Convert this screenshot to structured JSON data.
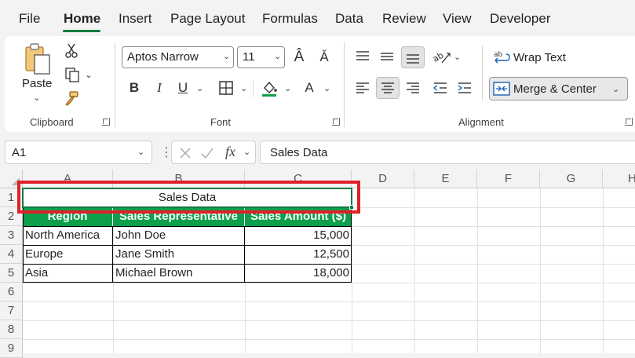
{
  "menu": {
    "tabs": [
      {
        "label": "File"
      },
      {
        "label": "Home"
      },
      {
        "label": "Insert"
      },
      {
        "label": "Page Layout"
      },
      {
        "label": "Formulas"
      },
      {
        "label": "Data"
      },
      {
        "label": "Review"
      },
      {
        "label": "View"
      },
      {
        "label": "Developer"
      }
    ],
    "active": "Home"
  },
  "ribbon": {
    "clipboard": {
      "label": "Clipboard",
      "paste_label": "Paste"
    },
    "font": {
      "label": "Font",
      "font_name": "Aptos Narrow",
      "font_size": "11",
      "bold": "B",
      "italic": "I",
      "underline": "U",
      "font_color_glyph": "A"
    },
    "alignment": {
      "label": "Alignment",
      "wrap_text": "Wrap Text",
      "merge_center": "Merge & Center"
    }
  },
  "formula_bar": {
    "name_box": "A1",
    "fx": "fx",
    "content": "Sales Data"
  },
  "grid": {
    "columns": [
      "A",
      "B",
      "C",
      "D",
      "E",
      "F",
      "G",
      "H"
    ],
    "rows": [
      "1",
      "2",
      "3",
      "4",
      "5",
      "6",
      "7",
      "8",
      "9"
    ],
    "title": "Sales Data",
    "headers": [
      "Region",
      "Sales Representative",
      "Sales Amount ($)"
    ],
    "data": [
      [
        "North America",
        "John Doe",
        "15,000"
      ],
      [
        "Europe",
        "Jane Smith",
        "12,500"
      ],
      [
        "Asia",
        "Michael Brown",
        "18,000"
      ]
    ]
  },
  "colors": {
    "accent": "#0f7b3f",
    "header_fill": "#0e9f4b",
    "highlight_box": "#e0202a"
  }
}
